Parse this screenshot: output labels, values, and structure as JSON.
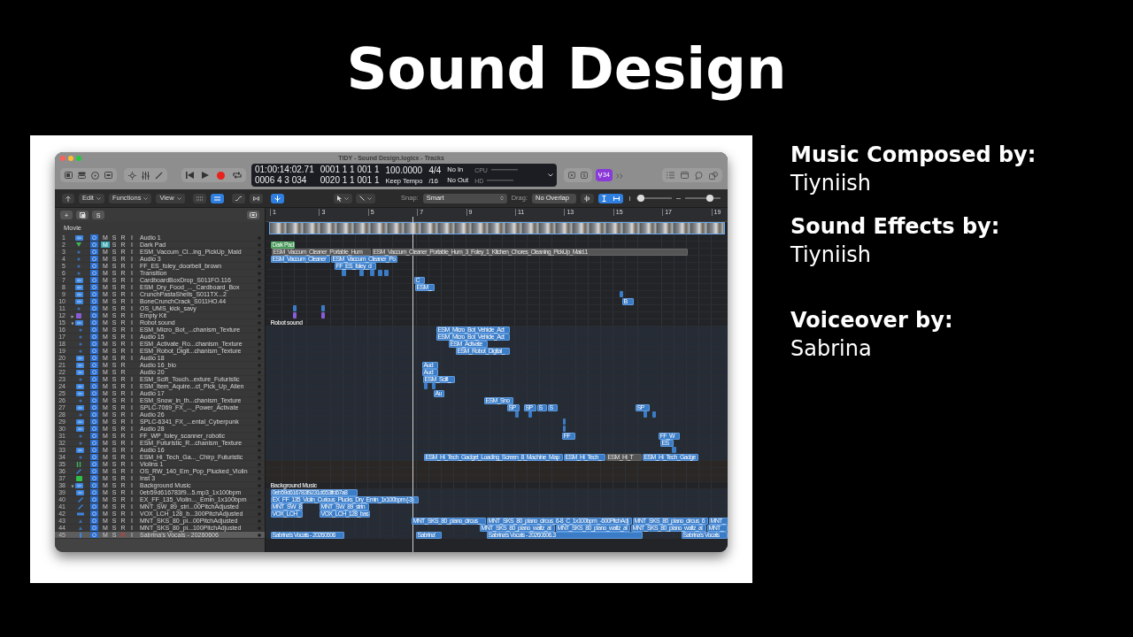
{
  "slide": {
    "title": "Sound Design",
    "credits": [
      {
        "role": "Music Composed by:",
        "name": "Tiyniish"
      },
      {
        "role": "Sound Effects by:",
        "name": "Tiyniish"
      },
      {
        "role": "Voiceover by:",
        "name": "Sabrina"
      }
    ]
  },
  "window": {
    "title": "TIDY - Sound Design.logicx - Tracks",
    "lcd": {
      "time": "01:00:14:02.71",
      "length": "0006 4 3 034",
      "position": "0001 1 1 001 1",
      "end": "0020 1 1 001 1",
      "tempo": "100.0000",
      "tempo_mode": "Keep Tempo",
      "signature": "4/4",
      "division": "/16",
      "input": "No In",
      "output": "No Out",
      "cpu_label": "CPU",
      "hd_label": "HD"
    },
    "badge": "34",
    "menus": [
      "Edit",
      "Functions",
      "View"
    ],
    "snap": {
      "label": "Snap:",
      "value": "Smart"
    },
    "drag": {
      "label": "Drag:",
      "value": "No Overlap"
    },
    "zoom_sliders": [
      {
        "level": 0.12
      },
      {
        "level": 0.7
      }
    ],
    "header_buttons": [
      "+",
      "S"
    ],
    "ruler": [
      "1",
      "3",
      "5",
      "7",
      "9",
      "11",
      "13",
      "15",
      "17",
      "19"
    ],
    "movie_track": "Movie",
    "tracks": [
      {
        "number": "1",
        "name": "Audio 1",
        "kind": "audio",
        "buttons": [
          "M",
          "S",
          "R",
          "I"
        ],
        "muted": false,
        "record_armed": false,
        "selected": false
      },
      {
        "number": "2",
        "name": "Dark Pad",
        "kind": "synth",
        "buttons": [
          "M",
          "S",
          "R",
          "I"
        ],
        "muted": true,
        "record_armed": false,
        "selected": false,
        "regions": [
          {
            "label": "Dark Pad",
            "kind": "midi"
          }
        ]
      },
      {
        "number": "3",
        "name": "ESM_Vaccum_Cl...ing_PickUp_Maid",
        "kind": "dot",
        "buttons": [
          "M",
          "S",
          "R",
          "I"
        ],
        "muted": false,
        "record_armed": false,
        "selected": false,
        "regions": [
          {
            "label": "ESM_Vaccum_Cleaner_Portable_Hum",
            "kind": "muted"
          },
          {
            "label": "ESM_Vaccum_Cleaner_Portable_Hum_3_Foley_1_Kitchen_Chores_Cleaning_PickUp_Maid.1",
            "kind": "muted"
          }
        ]
      },
      {
        "number": "4",
        "name": "Audio 3",
        "kind": "dot",
        "buttons": [
          "M",
          "S",
          "R",
          "I"
        ],
        "muted": false,
        "record_armed": false,
        "selected": false,
        "regions": [
          {
            "label": "ESM_Vaccum_Cleaner",
            "kind": "audio"
          },
          {
            "label": "ESM_Vaccum_Cleaner_Po",
            "kind": "audio"
          }
        ]
      },
      {
        "number": "5",
        "name": "FF_ES_foley_doorbell_brown",
        "kind": "dot",
        "buttons": [
          "M",
          "S",
          "R",
          "I"
        ],
        "muted": false,
        "record_armed": false,
        "selected": false,
        "regions": [
          {
            "label": "FF_ES_foley_d",
            "kind": "audio"
          }
        ]
      },
      {
        "number": "6",
        "name": "Transition",
        "kind": "dot",
        "buttons": [
          "M",
          "S",
          "R",
          "I"
        ],
        "muted": false,
        "record_armed": false,
        "selected": false
      },
      {
        "number": "7",
        "name": "CardboardBoxDrop_S011FO.116",
        "kind": "audio",
        "buttons": [
          "M",
          "S",
          "R",
          "I"
        ],
        "muted": false,
        "record_armed": false,
        "selected": false,
        "regions": [
          {
            "label": "C",
            "kind": "audio"
          }
        ]
      },
      {
        "number": "8",
        "name": "ESM_Dry_Food_..._Cardboard_Box",
        "kind": "audio",
        "buttons": [
          "M",
          "S",
          "R",
          "I"
        ],
        "muted": false,
        "record_armed": false,
        "selected": false,
        "regions": [
          {
            "label": "ESM_",
            "kind": "audio"
          }
        ]
      },
      {
        "number": "9",
        "name": "CrunchPastaShells_S011TX...2",
        "kind": "audio",
        "buttons": [
          "M",
          "S",
          "R",
          "I"
        ],
        "muted": false,
        "record_armed": false,
        "selected": false
      },
      {
        "number": "10",
        "name": "BoneCrunchCrack_S011HO.44",
        "kind": "audio",
        "buttons": [
          "M",
          "S",
          "R",
          "I"
        ],
        "muted": false,
        "record_armed": false,
        "selected": false,
        "regions": [
          {
            "label": "B",
            "kind": "audio"
          }
        ]
      },
      {
        "number": "11",
        "name": "OS_UMS_kick_savy",
        "kind": "dot",
        "buttons": [
          "M",
          "S",
          "R",
          "I"
        ],
        "muted": false,
        "record_armed": false,
        "selected": false
      },
      {
        "number": "12",
        "name": "Empty Kit",
        "kind": "drum",
        "buttons": [
          "M",
          "S",
          "R",
          "I"
        ],
        "muted": false,
        "record_armed": false,
        "selected": false,
        "expanded": false
      },
      {
        "number": "15",
        "name": "Robot sound",
        "kind": "audio",
        "buttons": [
          "M",
          "S",
          "R",
          "I"
        ],
        "muted": false,
        "record_armed": false,
        "selected": false,
        "expanded": true,
        "regions": [
          {
            "label": "Robot sound",
            "kind": "folder"
          }
        ],
        "children": [
          {
            "number": "16",
            "name": "ESM_Micro_Bot_...chanism_Texture",
            "kind": "dot",
            "buttons": [
              "M",
              "S",
              "R",
              "I"
            ],
            "muted": false,
            "record_armed": false,
            "selected": false,
            "regions": [
              {
                "label": "ESM_Micro_Bot_Vehicle_Act",
                "kind": "audio"
              }
            ]
          },
          {
            "number": "17",
            "name": "Audio 15",
            "kind": "dot",
            "buttons": [
              "M",
              "S",
              "R",
              "I"
            ],
            "muted": false,
            "record_armed": false,
            "selected": false,
            "regions": [
              {
                "label": "ESM_Micro_Bot_Vehicle_Act",
                "kind": "audio"
              }
            ]
          },
          {
            "number": "18",
            "name": "ESM_Activate_Ro...chanism_Texture",
            "kind": "dot",
            "buttons": [
              "M",
              "S",
              "R",
              "I"
            ],
            "muted": false,
            "record_armed": false,
            "selected": false,
            "regions": [
              {
                "label": "ESM_Activate",
                "kind": "audio"
              }
            ]
          },
          {
            "number": "19",
            "name": "ESM_Robot_Digit...chanism_Texture",
            "kind": "dot",
            "buttons": [
              "M",
              "S",
              "R",
              "I"
            ],
            "muted": false,
            "record_armed": false,
            "selected": false,
            "regions": [
              {
                "label": "ESM_Robot_Digital_",
                "kind": "audio"
              }
            ]
          },
          {
            "number": "20",
            "name": "Audio 18",
            "kind": "audio",
            "buttons": [
              "M",
              "S",
              "R",
              "I"
            ],
            "muted": false,
            "record_armed": false,
            "selected": false
          },
          {
            "number": "21",
            "name": "Audio 16_bio",
            "kind": "audio",
            "buttons": [
              "M",
              "S",
              "R"
            ],
            "muted": false,
            "record_armed": false,
            "selected": false,
            "regions": [
              {
                "label": "Aud",
                "kind": "audio"
              }
            ]
          },
          {
            "number": "22",
            "name": "Audio 20",
            "kind": "audio",
            "buttons": [
              "M",
              "S",
              "R"
            ],
            "muted": false,
            "record_armed": false,
            "selected": false,
            "regions": [
              {
                "label": "Aud",
                "kind": "audio"
              }
            ]
          },
          {
            "number": "23",
            "name": "ESM_Scifi_Touch...exture_Futuristic",
            "kind": "dot",
            "buttons": [
              "M",
              "S",
              "R",
              "I"
            ],
            "muted": false,
            "record_armed": false,
            "selected": false,
            "regions": [
              {
                "label": "ESM_Scifi_",
                "kind": "audio"
              }
            ]
          },
          {
            "number": "24",
            "name": "ESM_Item_Aquire...ct_Pick_Up_Alien",
            "kind": "audio",
            "buttons": [
              "M",
              "S",
              "R",
              "I"
            ],
            "muted": false,
            "record_armed": false,
            "selected": false
          },
          {
            "number": "25",
            "name": "Audio 17",
            "kind": "audio",
            "buttons": [
              "M",
              "S",
              "R",
              "I"
            ],
            "muted": false,
            "record_armed": false,
            "selected": false,
            "regions": [
              {
                "label": "Au",
                "kind": "audio"
              }
            ]
          },
          {
            "number": "26",
            "name": "ESM_Snow_in_th...chanism_Texture",
            "kind": "dot",
            "buttons": [
              "M",
              "S",
              "R",
              "I"
            ],
            "muted": false,
            "record_armed": false,
            "selected": false,
            "regions": [
              {
                "label": "ESM_Sno",
                "kind": "audio"
              }
            ]
          },
          {
            "number": "27",
            "name": "SPLC-7069_FX_..._Power_Activate",
            "kind": "audio",
            "buttons": [
              "M",
              "S",
              "R",
              "I"
            ],
            "muted": false,
            "record_armed": false,
            "selected": false,
            "regions": [
              {
                "label": "SP",
                "kind": "audio"
              },
              {
                "label": "SP",
                "kind": "audio"
              },
              {
                "label": "S",
                "kind": "audio"
              },
              {
                "label": "S",
                "kind": "audio"
              },
              {
                "label": "SP",
                "kind": "audio"
              }
            ]
          },
          {
            "number": "28",
            "name": "Audio 26",
            "kind": "dot",
            "buttons": [
              "M",
              "S",
              "R",
              "I"
            ],
            "muted": false,
            "record_armed": false,
            "selected": false
          },
          {
            "number": "29",
            "name": "SPLC-6341_FX_...ental_Cyberpunk",
            "kind": "audio",
            "buttons": [
              "M",
              "S",
              "R",
              "I"
            ],
            "muted": false,
            "record_armed": false,
            "selected": false
          },
          {
            "number": "30",
            "name": "Audio 28",
            "kind": "audio",
            "buttons": [
              "M",
              "S",
              "R",
              "I"
            ],
            "muted": false,
            "record_armed": false,
            "selected": false
          },
          {
            "number": "31",
            "name": "FF_WP_foley_scanner_robotic",
            "kind": "dot",
            "buttons": [
              "M",
              "S",
              "R",
              "I"
            ],
            "muted": false,
            "record_armed": false,
            "selected": false,
            "regions": [
              {
                "label": "FF",
                "kind": "audio"
              },
              {
                "label": "FF_W",
                "kind": "audio"
              }
            ]
          },
          {
            "number": "32",
            "name": "ESM_Futuristic_R...chanism_Texture",
            "kind": "dot",
            "buttons": [
              "M",
              "S",
              "R",
              "I"
            ],
            "muted": false,
            "record_armed": false,
            "selected": false,
            "regions": [
              {
                "label": "ES",
                "kind": "audio"
              }
            ]
          },
          {
            "number": "33",
            "name": "Audio 16",
            "kind": "audio",
            "buttons": [
              "M",
              "S",
              "R",
              "I"
            ],
            "muted": false,
            "record_armed": false,
            "selected": false
          },
          {
            "number": "34",
            "name": "ESM_Hi_Tech_Ga..._Chirp_Futuristic",
            "kind": "dot",
            "buttons": [
              "M",
              "S",
              "R",
              "I"
            ],
            "muted": false,
            "record_armed": false,
            "selected": false,
            "regions": [
              {
                "label": "ESM_Hi_Tech_Gadget_Loading_Screen_8_Machine_Map",
                "kind": "audio"
              },
              {
                "label": "ESM_Hi_Tech_",
                "kind": "audio"
              },
              {
                "label": "ESM_Hi_T",
                "kind": "muted"
              },
              {
                "label": "ESM_Hi_Tech_Gadge",
                "kind": "audio"
              }
            ]
          }
        ]
      },
      {
        "number": "35",
        "name": "Violins 1",
        "kind": "strings",
        "buttons": [
          "M",
          "S",
          "R",
          "I"
        ],
        "muted": false,
        "record_armed": false,
        "selected": false
      },
      {
        "number": "36",
        "name": "OS_RW_140_Em_Pop_Plucked_Violin",
        "kind": "pencil",
        "buttons": [
          "M",
          "S",
          "R",
          "I"
        ],
        "muted": false,
        "record_armed": false,
        "selected": false
      },
      {
        "number": "37",
        "name": "Inst 3",
        "kind": "inst",
        "buttons": [
          "M",
          "S",
          "R",
          "I"
        ],
        "muted": false,
        "record_armed": false,
        "selected": false
      },
      {
        "number": "38",
        "name": "Background Music",
        "kind": "audio",
        "buttons": [
          "M",
          "S",
          "R",
          "I"
        ],
        "muted": false,
        "record_armed": false,
        "selected": false,
        "expanded": true,
        "regions": [
          {
            "label": "Background Music",
            "kind": "folder"
          }
        ],
        "children": [
          {
            "number": "39",
            "name": "0eb59d616783f9...5.mp3_1x100bpm",
            "kind": "audio",
            "buttons": [
              "M",
              "S",
              "R",
              "I"
            ],
            "muted": false,
            "record_armed": false,
            "selected": false,
            "regions": [
              {
                "label": "0eb59d616783f9231d653ffd67a8",
                "kind": "audio"
              }
            ]
          },
          {
            "number": "40",
            "name": "EX_FF_135_Violin..._Emin_1x100bpm",
            "kind": "pencil",
            "buttons": [
              "M",
              "S",
              "R",
              "I"
            ],
            "muted": false,
            "record_armed": false,
            "selected": false,
            "regions": [
              {
                "label": "EX_FF_135_Violin_Curious_Plucks_Dry_Emin_1x100bpm (-3)",
                "kind": "audio"
              }
            ]
          },
          {
            "number": "41",
            "name": "MNT_SW_89_stri...00PitchAdjusted",
            "kind": "pencil",
            "buttons": [
              "M",
              "S",
              "R",
              "I"
            ],
            "muted": false,
            "record_armed": false,
            "selected": false,
            "regions": [
              {
                "label": "MNT_SW_8",
                "kind": "audio"
              },
              {
                "label": "MNT_SW_89_strin",
                "kind": "audio"
              }
            ]
          },
          {
            "number": "42",
            "name": "VOX_LCH_128_b...300PitchAdjusted",
            "kind": "keys",
            "buttons": [
              "M",
              "S",
              "R",
              "I"
            ],
            "muted": false,
            "record_armed": false,
            "selected": false,
            "regions": [
              {
                "label": "VOX_LCH_",
                "kind": "audio"
              },
              {
                "label": "VOX_LCH_128_bas",
                "kind": "audio"
              }
            ]
          },
          {
            "number": "43",
            "name": "MNT_SKS_80_pi...00PitchAdjusted",
            "kind": "hand",
            "buttons": [
              "M",
              "S",
              "R",
              "I"
            ],
            "muted": false,
            "record_armed": false,
            "selected": false,
            "regions": [
              {
                "label": "MNT_SKS_80_piano_circus_",
                "kind": "audio"
              },
              {
                "label": "MNT_SKS_80_piano_circus_6-8_C_1x100bpm_-600PitchAdj",
                "kind": "audio"
              },
              {
                "label": "MNT_SKS_80_piano_circus_6",
                "kind": "audio"
              },
              {
                "label": "MNT_",
                "kind": "audio"
              }
            ]
          },
          {
            "number": "44",
            "name": "MNT_SKS_80_pi...100PitchAdjusted",
            "kind": "hand",
            "buttons": [
              "M",
              "S",
              "R",
              "I"
            ],
            "muted": false,
            "record_armed": false,
            "selected": false,
            "regions": [
              {
                "label": "MNT_SKS_80_piano_waltz_al",
                "kind": "audio"
              },
              {
                "label": "MNT_SKS_80_piano_waltz_al",
                "kind": "audio"
              },
              {
                "label": "MNT_SKS_80_piano_waltz_al",
                "kind": "audio"
              },
              {
                "label": "MNT_",
                "kind": "audio"
              }
            ]
          },
          {
            "number": "45",
            "name": "Sabrina's Vocals - 20260606",
            "kind": "mic",
            "buttons": [
              "M",
              "S",
              "R",
              "I"
            ],
            "muted": false,
            "record_armed": true,
            "selected": true,
            "regions": [
              {
                "label": "Sabrina's Vocals - 20260606",
                "kind": "audio"
              },
              {
                "label": "Sabrina'",
                "kind": "audio"
              },
              {
                "label": "Sabrina's Vocals - 20260606.3",
                "kind": "audio"
              },
              {
                "label": "Sabrina's Vocals",
                "kind": "audio"
              }
            ]
          }
        ]
      }
    ]
  }
}
